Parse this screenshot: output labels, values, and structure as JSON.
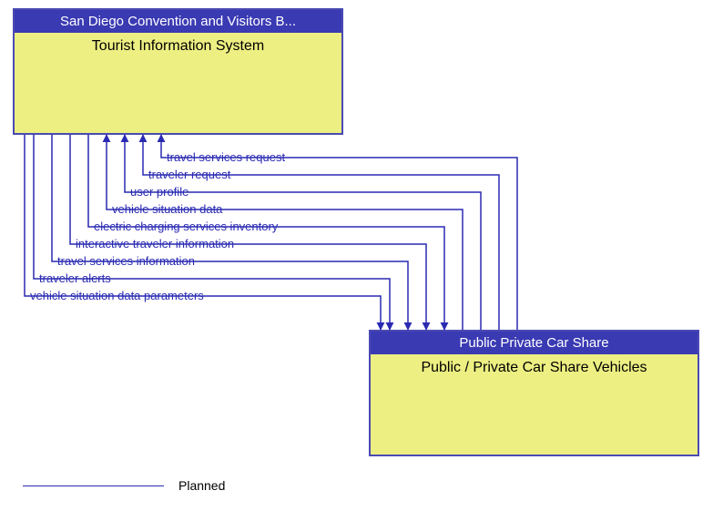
{
  "box1": {
    "header": "San Diego Convention and Visitors B...",
    "body": "Tourist Information System"
  },
  "box2": {
    "header": "Public Private Car Share",
    "body": "Public / Private Car Share Vehicles"
  },
  "flows": {
    "to_box1": [
      "travel services request",
      "traveler request",
      "user profile",
      "vehicle situation data"
    ],
    "to_box2": [
      "electric charging services inventory",
      "interactive traveler information",
      "travel services information",
      "traveler alerts",
      "vehicle situation data parameters"
    ]
  },
  "legend": {
    "label": "Planned"
  }
}
